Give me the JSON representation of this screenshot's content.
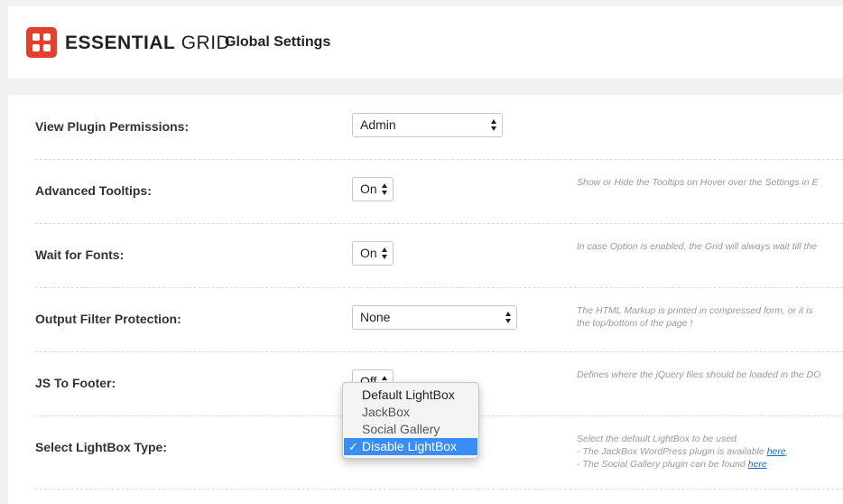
{
  "header": {
    "brand_bold": "ESSENTIAL",
    "brand_light": "GRID",
    "page_title": "Global Settings",
    "brand_color": "#e2412e"
  },
  "settings": [
    {
      "label": "View Plugin Permissions:",
      "value": "Admin",
      "description": []
    },
    {
      "label": "Advanced Tooltips:",
      "value": "On",
      "description": [
        "Show or Hide the Tooltips on Hover over the Settings in E"
      ]
    },
    {
      "label": "Wait for Fonts:",
      "value": "On",
      "description": [
        "In case Option is enabled, the Grid will always wait till the"
      ]
    },
    {
      "label": "Output Filter Protection:",
      "value": "None",
      "description": [
        "The HTML Markup is printed in compressed form, or it is",
        "the top/bottom of the page !"
      ]
    },
    {
      "label": "JS To Footer:",
      "value": "Off",
      "description": [
        "Defines where the jQuery files should be loaded in the DO"
      ]
    },
    {
      "label": "Select LightBox Type:",
      "value": "Disable LightBox",
      "description": [
        "Select the default LightBox to be used.",
        "- The JackBox WordPress plugin is available",
        "- The Social Gallery plugin can be found"
      ],
      "link_text": "here"
    }
  ],
  "lightbox_dropdown": {
    "options": [
      "Default LightBox",
      "JackBox",
      "Social Gallery",
      "Disable LightBox"
    ],
    "selected": "Disable LightBox",
    "check_glyph": "✓"
  }
}
